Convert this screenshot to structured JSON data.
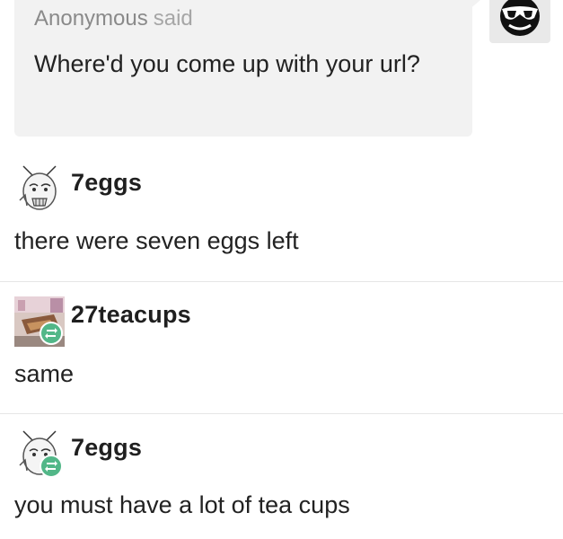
{
  "ask": {
    "asker": "Anonymous",
    "said": "said",
    "question": "Where'd you come up with your url?"
  },
  "replies": [
    {
      "username": "7eggs",
      "text": "there were seven eggs left",
      "reblog": false
    },
    {
      "username": "27teacups",
      "text": "same",
      "reblog": true
    },
    {
      "username": "7eggs",
      "text": "you must have a lot of tea cups",
      "reblog": true
    }
  ],
  "colors": {
    "ask_background": "#f2f2f2",
    "reblog_badge": "#52b788",
    "divider": "#e6e6e6"
  },
  "icons": {
    "anon_avatar": "sunglasses-face-icon",
    "reblog": "reblog-icon"
  }
}
